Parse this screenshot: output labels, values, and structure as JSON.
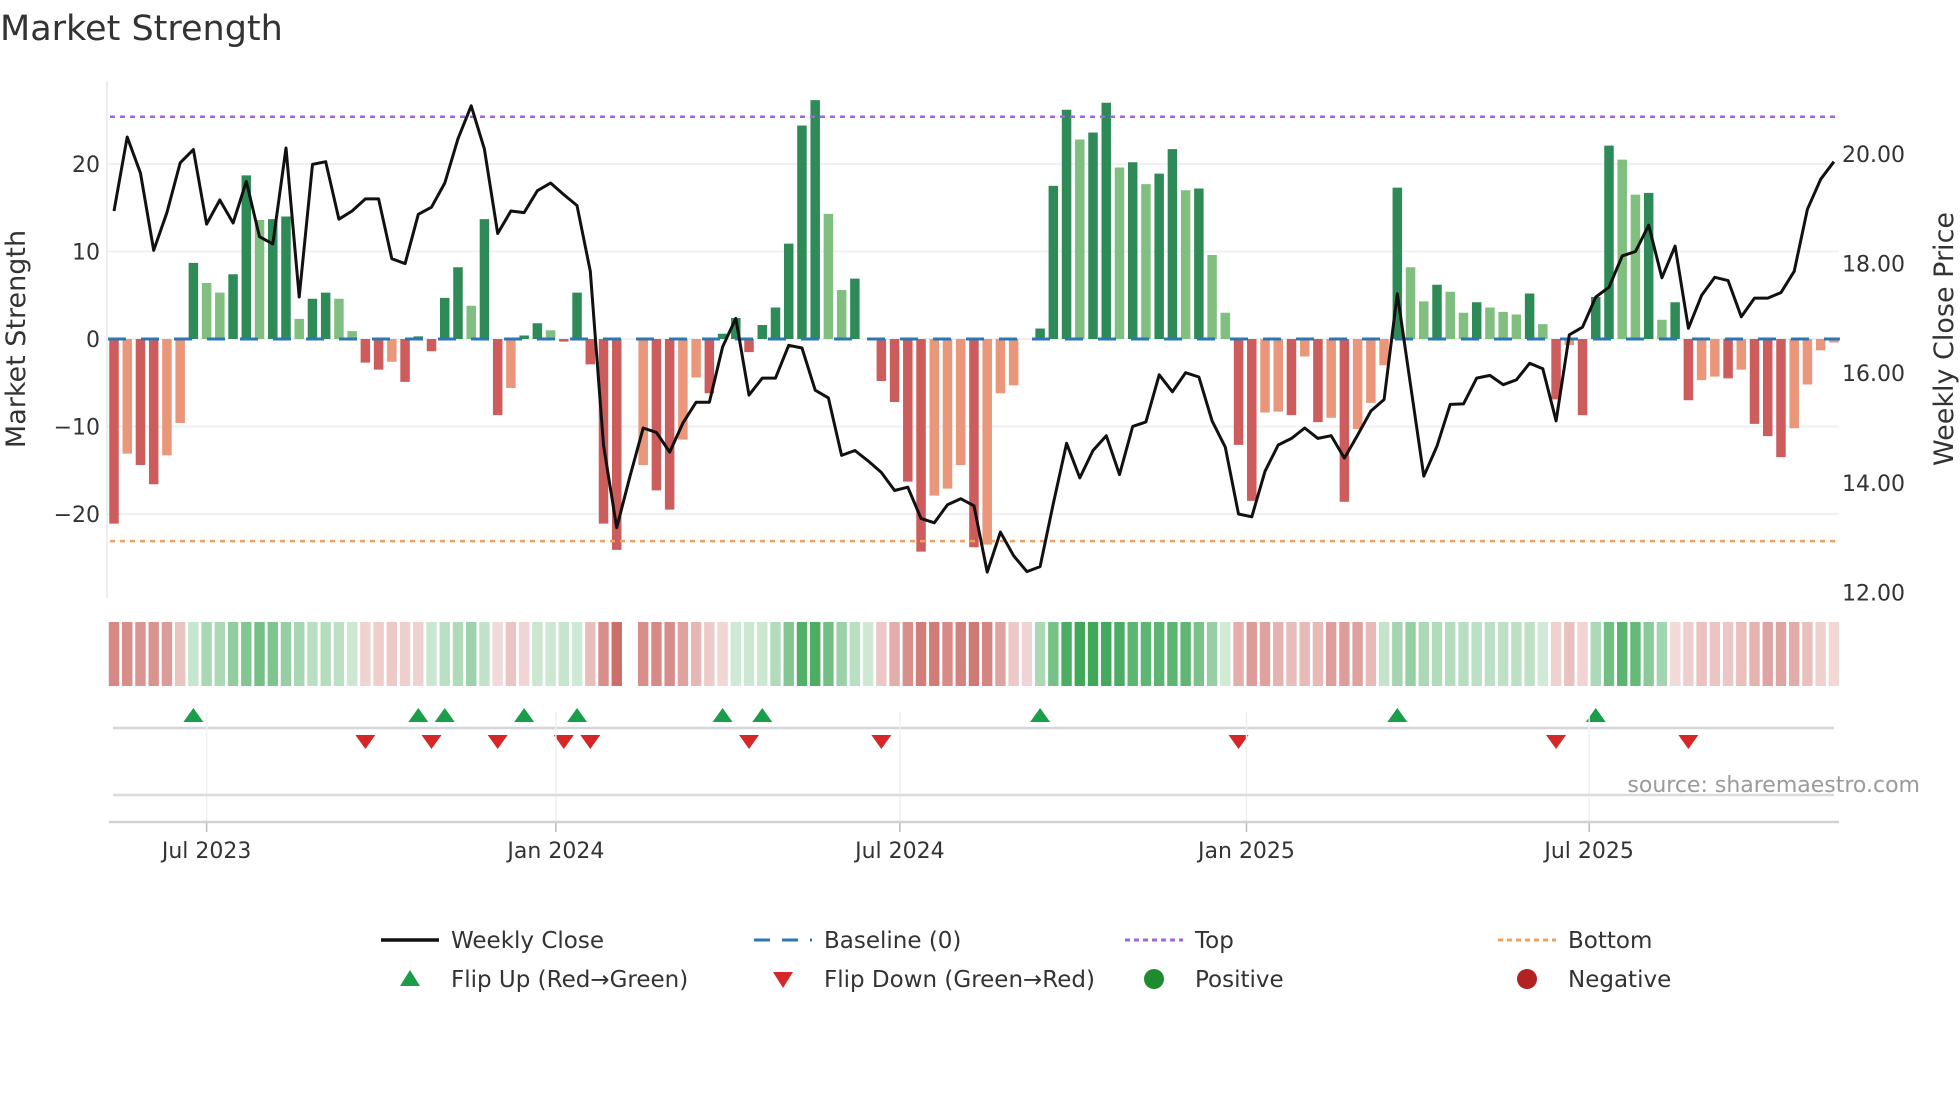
{
  "title": "Market Strength",
  "source": "source: sharemaestro.com",
  "colors": {
    "green_strong": "#2e8b57",
    "green_weak": "#80bf80",
    "red_strong": "#cd5c5c",
    "red_weak": "#e9967a",
    "baseline": "#2a77b4",
    "top": "#a066e0",
    "bottom": "#f0a060",
    "close": "#111111",
    "flip_up": "#1a9e4a",
    "flip_down": "#d62728",
    "positive": "#1e8c2e",
    "negative": "#b22222"
  },
  "chart_data": {
    "type": "bar",
    "title": "Market Strength",
    "ylabel": "Market Strength",
    "y2label": "Weekly Close Price",
    "ylim": [
      -29,
      30
    ],
    "y2lim": [
      12.0,
      21.0
    ],
    "yticks": [
      {
        "v": 20,
        "label": "20"
      },
      {
        "v": 10,
        "label": "10"
      },
      {
        "v": 0,
        "label": "0"
      },
      {
        "v": -10,
        "label": "−10"
      },
      {
        "v": -20,
        "label": "−20"
      }
    ],
    "y2ticks": [
      {
        "v": 20,
        "label": "20.00"
      },
      {
        "v": 18,
        "label": "18.00"
      },
      {
        "v": 16,
        "label": "16.00"
      },
      {
        "v": 14,
        "label": "14.00"
      },
      {
        "v": 12,
        "label": "12.00"
      }
    ],
    "xticks": [
      {
        "week": 7,
        "label": "Jul 2023"
      },
      {
        "week": 33.4,
        "label": "Jan 2024"
      },
      {
        "week": 59.4,
        "label": "Jul 2024"
      },
      {
        "week": 85.6,
        "label": "Jan 2025"
      },
      {
        "week": 111.5,
        "label": "Jul 2025"
      }
    ],
    "top_level": 25.4,
    "bottom_level": -23.1,
    "baseline": 0,
    "strength": [
      -21.1,
      -13.1,
      -14.4,
      -16.6,
      -13.3,
      -9.6,
      8.7,
      6.4,
      5.3,
      7.4,
      18.7,
      13.6,
      13.7,
      14.0,
      2.3,
      4.6,
      5.3,
      4.6,
      0.9,
      -2.7,
      -3.5,
      -2.6,
      -4.9,
      0.3,
      -1.4,
      4.7,
      8.2,
      3.8,
      13.7,
      -8.7,
      -5.6,
      0.4,
      1.8,
      1.0,
      -0.3,
      5.3,
      -2.9,
      -21.1,
      -24.1,
      null,
      -14.4,
      -17.3,
      -19.5,
      -11.5,
      -4.4,
      -6.2,
      0.6,
      2.4,
      -1.5,
      1.6,
      3.6,
      10.9,
      24.4,
      27.3,
      14.3,
      5.6,
      6.9,
      0,
      -4.8,
      -7.2,
      -16.3,
      -24.3,
      -17.9,
      -17.1,
      -14.4,
      -23.8,
      -23.5,
      -6.2,
      -5.3,
      0,
      1.2,
      17.5,
      26.2,
      22.8,
      23.6,
      27.0,
      19.6,
      20.2,
      17.7,
      18.9,
      21.7,
      17.0,
      17.2,
      9.6,
      3.0,
      -12.1,
      -18.5,
      -8.4,
      -8.3,
      -8.7,
      -2.0,
      -9.5,
      -9.0,
      -18.6,
      -10.3,
      -7.3,
      -3.0,
      17.3,
      8.2,
      4.3,
      6.2,
      5.4,
      3.0,
      4.2,
      3.6,
      3.1,
      2.8,
      5.2,
      1.7,
      -6.9,
      -0.7,
      -8.7,
      4.8,
      22.1,
      20.5,
      16.5,
      16.7,
      2.2,
      4.2,
      -7.0,
      -4.7,
      -4.3,
      -4.5,
      -3.5,
      -9.7,
      -11.1,
      -13.5,
      -10.2,
      -5.2,
      -1.3,
      -0.4
    ],
    "weekly_close": [
      18.96,
      20.31,
      19.65,
      18.24,
      18.93,
      19.84,
      20.08,
      18.72,
      19.16,
      18.74,
      19.5,
      18.49,
      18.36,
      20.11,
      17.39,
      19.81,
      19.86,
      18.81,
      18.96,
      19.18,
      19.18,
      18.09,
      18.0,
      18.9,
      19.03,
      19.47,
      20.28,
      20.88,
      20.09,
      18.55,
      18.96,
      18.93,
      19.33,
      19.47,
      19.26,
      19.06,
      17.86,
      14.69,
      13.18,
      14.12,
      15.0,
      14.92,
      14.56,
      15.09,
      15.47,
      15.47,
      16.48,
      17.0,
      15.6,
      15.91,
      15.91,
      16.51,
      16.46,
      15.69,
      15.55,
      14.5,
      14.59,
      14.4,
      14.19,
      13.86,
      13.92,
      13.35,
      13.27,
      13.6,
      13.71,
      13.58,
      12.37,
      13.1,
      12.67,
      12.38,
      12.47,
      13.62,
      14.72,
      14.09,
      14.59,
      14.86,
      14.15,
      15.03,
      15.11,
      15.97,
      15.66,
      16.01,
      15.93,
      15.13,
      14.65,
      13.43,
      13.38,
      14.21,
      14.69,
      14.81,
      15.0,
      14.81,
      14.86,
      14.45,
      14.87,
      15.31,
      15.52,
      17.45,
      15.79,
      14.12,
      14.67,
      15.43,
      15.44,
      15.91,
      15.96,
      15.79,
      15.88,
      16.18,
      16.08,
      15.13,
      16.7,
      16.84,
      17.39,
      17.57,
      18.14,
      18.22,
      18.7,
      17.74,
      18.32,
      16.82,
      17.42,
      17.75,
      17.69,
      17.03,
      17.37,
      17.37,
      17.47,
      17.86,
      18.99,
      19.54,
      19.86
    ],
    "flip_up_weeks": [
      6,
      23,
      25,
      31,
      35,
      46,
      49,
      70,
      97,
      112
    ],
    "flip_down_weeks": [
      19,
      24,
      29,
      34,
      36,
      48,
      58,
      85,
      109,
      119
    ],
    "legend": {
      "placement": "bottom",
      "items": [
        {
          "key": "close",
          "label": "Weekly Close"
        },
        {
          "key": "baseline",
          "label": "Baseline (0)"
        },
        {
          "key": "top",
          "label": "Top"
        },
        {
          "key": "bottom",
          "label": "Bottom"
        },
        {
          "key": "flip_up",
          "label": "Flip Up (Red→Green)"
        },
        {
          "key": "flip_down",
          "label": "Flip Down (Green→Red)"
        },
        {
          "key": "positive",
          "label": "Positive"
        },
        {
          "key": "negative",
          "label": "Negative"
        }
      ]
    }
  }
}
